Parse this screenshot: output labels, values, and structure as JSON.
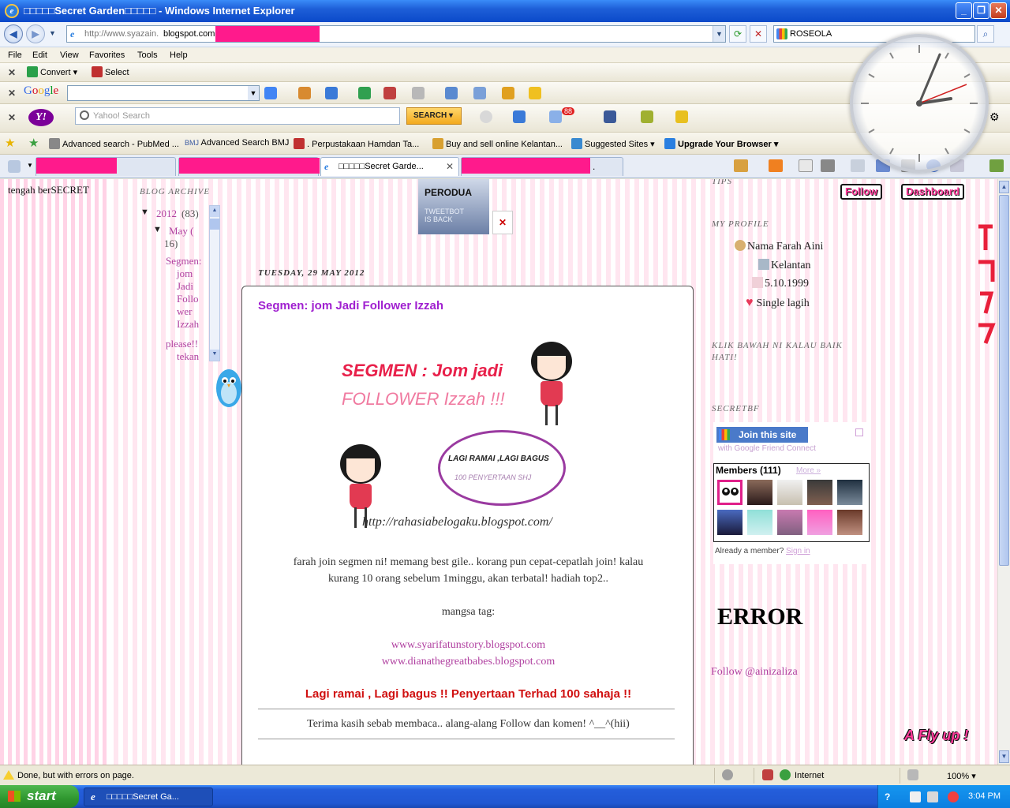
{
  "window": {
    "title": "□□□□□Secret Garden□□□□□ - Windows Internet Explorer",
    "minimize": "_",
    "maximize": "❐",
    "close": "✕"
  },
  "address": {
    "url_prefix": "http://www.syazain.",
    "url_host": "blogspot.com"
  },
  "search": {
    "provider_value": "ROSEOLA"
  },
  "menu": [
    "File",
    "Edit",
    "View",
    "Favorites",
    "Tools",
    "Help"
  ],
  "toolbar_convert": {
    "convert": "Convert",
    "select": "Select"
  },
  "google_toolbar": {
    "logo": "Google"
  },
  "yahoo_toolbar": {
    "logo": "Y!",
    "placeholder": "Yahoo! Search",
    "search_btn": "SEARCH",
    "badge": "88"
  },
  "favorites": [
    "Advanced search - PubMed ...",
    "Advanced Search  BMJ",
    ". Perpustakaan Hamdan Ta...",
    "Buy and sell online Kelantan...",
    "Suggested Sites ▾",
    "Upgrade Your Browser ▾"
  ],
  "tabs": {
    "active_label": "□□□□□Secret Garde...",
    "close": "✕",
    "extra_char": "."
  },
  "left": {
    "text": "tengah berSECRET"
  },
  "archive": {
    "title": "BLOG ARCHIVE",
    "year": "2012",
    "year_count": "(83)",
    "month": "May (",
    "month_count": "16)",
    "post_lines": [
      "Segmen:",
      "jom",
      "Jadi",
      "Follo",
      "wer",
      "Izzah"
    ],
    "next": "please!!",
    "next2": "tekan"
  },
  "widget": {
    "perodua": "PERODUA",
    "tweetbot": "TWEETBOT\nIS BACK"
  },
  "post": {
    "date": "TUESDAY, 29 MAY 2012",
    "title": "Segmen: jom Jadi Follower Izzah",
    "banner_line1": "SEGMEN : Jom jadi",
    "banner_line2": "FOLLOWER Izzah !!!",
    "banner_oval1": "LAGI RAMAI ,LAGI BAGUS",
    "banner_oval2": "100 PENYERTAAN SHJ",
    "banner_url": "http://rahasiabelogaku.blogspot.com/",
    "para1": "farah join segmen ni! memang best gile.. korang pun cepat-cepatlah join! kalau",
    "para2": "kurang 10 orang sebelum 1minggu, akan terbatal! hadiah top2..",
    "tag": "mangsa tag:",
    "link1": "www.syarifatunstory.blogspot.com",
    "link2": "www.dianathegreatbabes.blogspot.com",
    "highlight": "Lagi ramai , Lagi bagus !! Penyertaan Terhad 100 sahaja !!",
    "thanks": "Terima kasih sebab membaca.. alang-alang Follow dan komen! ^__^(hii)"
  },
  "sidebar": {
    "top_partial": "TIPS",
    "follow_btn": "Follow",
    "dashboard_btn": "Dashboard",
    "profile_title": "MY PROFILE",
    "profile_name": "Nama Farah Aini",
    "profile_location": "Kelantan",
    "profile_dob": "5.10.1999",
    "profile_status": "Single lagih",
    "klik_title": "KLIK BAWAH NI KALAU BAIK HATI!",
    "secretbf_title": "SECRETBF",
    "join": "Join this site",
    "with_gfc": "with Google Friend Connect",
    "members": "Members (111)",
    "more": "More »",
    "already": "Already a member?",
    "sign_in": "Sign in",
    "error": "ERROR",
    "follow_link": "Follow @ainizaliza",
    "flyup": "A Fly up !"
  },
  "status": {
    "text": "Done, but with errors on page.",
    "zone": "Internet",
    "zoom": "100%"
  },
  "taskbar": {
    "start": "start",
    "task": "□□□□□Secret Ga...",
    "time": "3:04 PM"
  }
}
